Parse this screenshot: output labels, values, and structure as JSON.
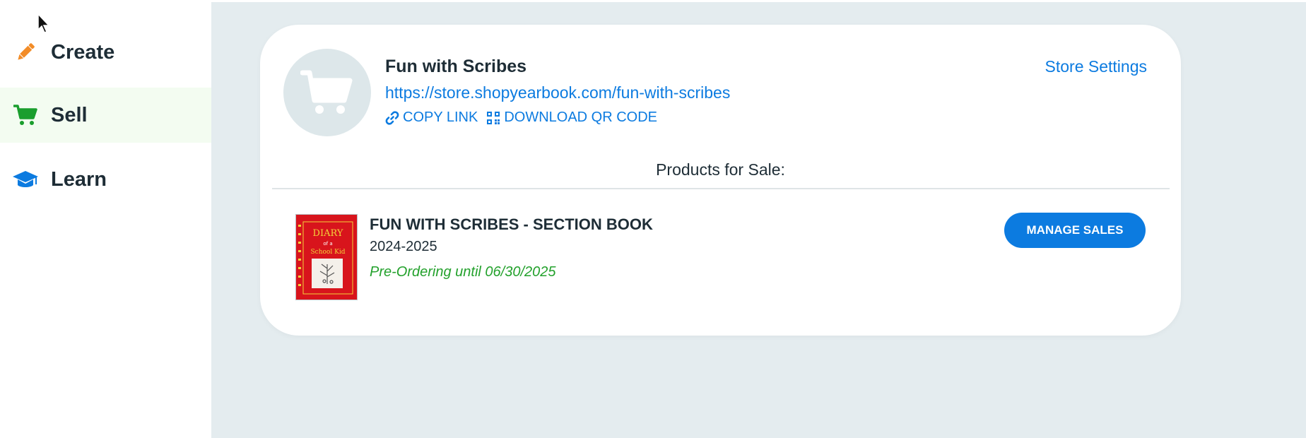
{
  "sidebar": {
    "items": [
      {
        "label": "Create",
        "icon": "pencil-icon"
      },
      {
        "label": "Sell",
        "icon": "shopping-cart-icon"
      },
      {
        "label": "Learn",
        "icon": "graduation-cap-icon"
      }
    ],
    "active": "Sell"
  },
  "store": {
    "name": "Fun with Scribes",
    "url": "https://store.shopyearbook.com/fun-with-scribes",
    "copy_link_label": "COPY LINK",
    "download_qr_label": "DOWNLOAD QR CODE",
    "settings_label": "Store Settings",
    "avatar_icon": "shopping-cart-icon"
  },
  "products": {
    "header": "Products for Sale:",
    "items": [
      {
        "title": "FUN WITH SCRIBES - SECTION BOOK",
        "year": "2024-2025",
        "status": "Pre-Ordering until 06/30/2025",
        "action_label": "MANAGE SALES",
        "cover_text_1": "DIARY",
        "cover_text_2": "of a",
        "cover_text_3": "School Kid"
      }
    ]
  },
  "colors": {
    "accent": "#0c7be0",
    "create_icon": "#f28c28",
    "sell_icon": "#1a9e2e",
    "learn_icon": "#0c7be0",
    "status_green": "#23a12c",
    "active_bg": "#f3fcf1",
    "background": "#e4ecef"
  }
}
